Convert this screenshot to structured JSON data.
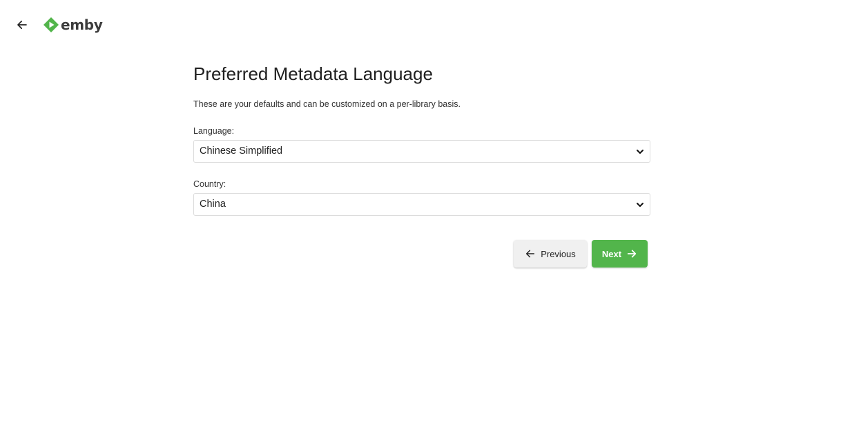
{
  "header": {
    "back_icon": "arrow-left-icon",
    "logo_text": "emby",
    "brand_color": "#52b54b"
  },
  "main": {
    "title": "Preferred Metadata Language",
    "subtitle": "These are your defaults and can be customized on a per-library basis.",
    "language": {
      "label": "Language:",
      "value": "Chinese Simplified",
      "icon": "chevron-down-icon"
    },
    "country": {
      "label": "Country:",
      "value": "China",
      "icon": "chevron-down-icon"
    }
  },
  "buttons": {
    "previous_label": "Previous",
    "previous_icon": "arrow-left-icon",
    "next_label": "Next",
    "next_icon": "arrow-right-icon",
    "next_color": "#52b54b"
  }
}
